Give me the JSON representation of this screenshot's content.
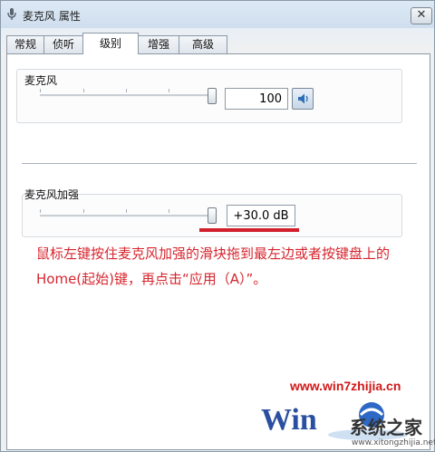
{
  "window": {
    "title": "麦克风 属性",
    "close": "✕"
  },
  "tabs": [
    {
      "label": "常规"
    },
    {
      "label": "侦听"
    },
    {
      "label": "级别"
    },
    {
      "label": "增强"
    },
    {
      "label": "高级"
    }
  ],
  "microphone": {
    "label": "麦克风",
    "value": "100",
    "level": 1.0
  },
  "boost": {
    "label": "麦克风加强",
    "value": "+30.0 dB",
    "level": 1.0
  },
  "annotation": {
    "line1": "鼠标左键按住麦克风加强的滑块拖到最左边或者按键盘上的",
    "line2": "Home(起始)键，再点击“应用（A）”。"
  },
  "watermark": {
    "site": "www.win7zhijia.cn",
    "brand": "系统之家",
    "url": "www.xitongzhijia.net"
  },
  "colors": {
    "annotation": "#d6252e",
    "underline": "#d21f2c",
    "watermark_site": "#d11818"
  },
  "icons": {
    "speaker": "speaker-icon",
    "app": "microphone-icon"
  }
}
